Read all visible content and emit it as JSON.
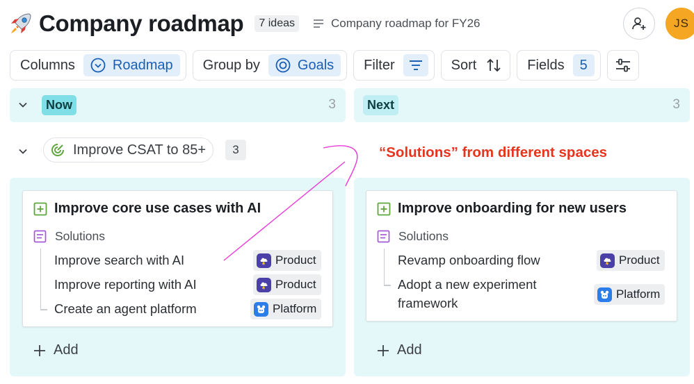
{
  "header": {
    "title": "Company roadmap",
    "ideas_count": "7 ideas",
    "description": "Company roadmap for FY26",
    "avatar_initials": "JS"
  },
  "toolbar": {
    "columns_label": "Columns",
    "columns_value": "Roadmap",
    "group_by_label": "Group by",
    "group_by_value": "Goals",
    "filter_label": "Filter",
    "sort_label": "Sort",
    "fields_label": "Fields",
    "fields_count": "5"
  },
  "columns": [
    {
      "tag": "Now",
      "count": "3",
      "tag_color": "#7fdee6"
    },
    {
      "tag": "Next",
      "count": "3",
      "tag_color": "#bfeef3"
    }
  ],
  "goal": {
    "label": "Improve CSAT to 85+",
    "count": "3"
  },
  "annotation": "“Solutions” from different spaces",
  "cards": [
    {
      "title": "Improve core use cases with AI",
      "section": "Solutions",
      "items": [
        {
          "text": "Improve search with AI",
          "space": "Product"
        },
        {
          "text": "Improve reporting with AI",
          "space": "Product"
        },
        {
          "text": "Create an agent platform",
          "space": "Platform"
        }
      ]
    },
    {
      "title": "Improve onboarding for new users",
      "section": "Solutions",
      "items": [
        {
          "text": "Revamp onboarding flow",
          "space": "Product"
        },
        {
          "text_line1": "Adopt a new experiment",
          "text_line2": "framework",
          "space": "Platform"
        }
      ]
    }
  ],
  "add_label": "Add",
  "colors": {
    "accent_blue": "#1a5fb4",
    "lane_bg": "#e4f8fa",
    "annotation_red": "#e8341c",
    "arrow_magenta": "#e83ad6",
    "avatar_orange": "#f5a623"
  }
}
